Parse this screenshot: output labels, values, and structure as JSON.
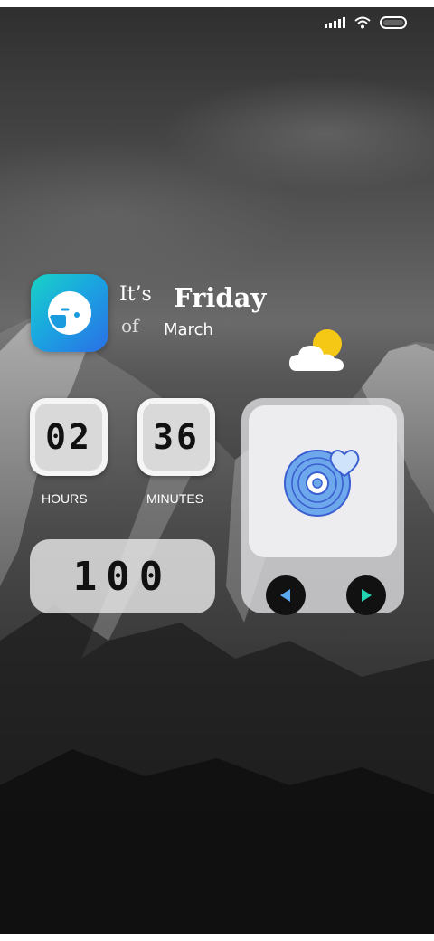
{
  "status_bar": {
    "icons": [
      "signal-icon",
      "wifi-icon",
      "battery-icon"
    ]
  },
  "app_icon": {
    "icon": "face-app-icon",
    "colors": [
      "#19d3c5",
      "#2b6fe6"
    ]
  },
  "date_widget": {
    "its": "It’s",
    "of": "of",
    "day": "Friday",
    "month": "March"
  },
  "weather": {
    "icon": "partly-sunny-icon"
  },
  "clock": {
    "hours": "02",
    "minutes": "36",
    "hours_label": "HOURS",
    "minutes_label": "MINUTES"
  },
  "counter": {
    "value": "100"
  },
  "music_widget": {
    "cover_icon": "vinyl-heart-icon",
    "prev_icon": "prev-icon",
    "next_icon": "next-icon",
    "colors": {
      "disc": "#6ea8ec",
      "prev": "#5aa8f0",
      "next": "#22d4b4"
    }
  }
}
